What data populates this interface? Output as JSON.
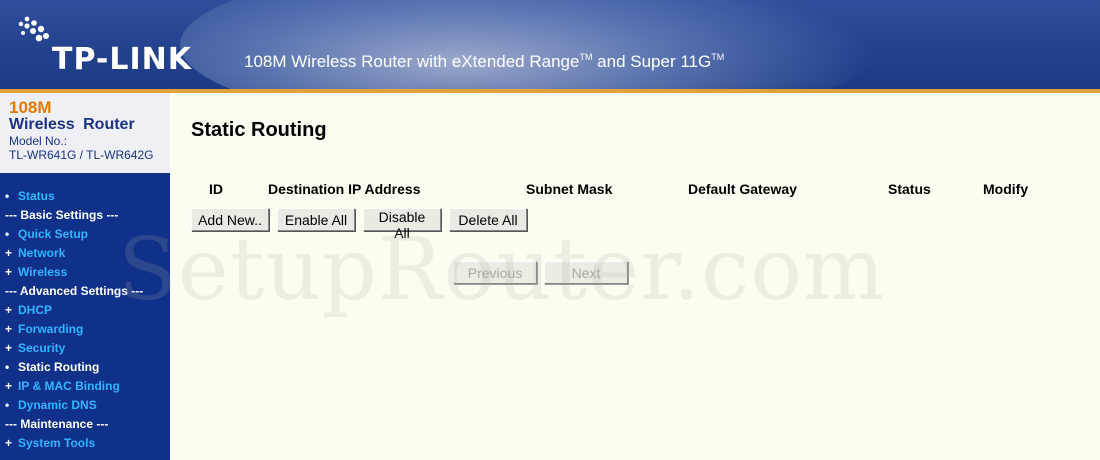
{
  "header": {
    "logo_text": "TP-LINK",
    "tagline_main": "108M Wireless Router with eXtended Range",
    "tagline_tm1": "TM",
    "tagline_mid": " and Super 11G",
    "tagline_tm2": "TM",
    "colors": {
      "header_bg": "#22408c",
      "accent_bar": "#e2a23a"
    }
  },
  "brand": {
    "line1": "108M",
    "line2": "Wireless Router",
    "line3": "Model No.:",
    "line4": "TL-WR641G / TL-WR642G"
  },
  "sidebar": {
    "items": [
      {
        "type": "link",
        "bullet": "•",
        "label": "Status"
      },
      {
        "type": "section",
        "bullet": "",
        "label": "--- Basic Settings ---"
      },
      {
        "type": "link",
        "bullet": "•",
        "label": "Quick Setup"
      },
      {
        "type": "link",
        "bullet": "+",
        "label": "Network"
      },
      {
        "type": "link",
        "bullet": "+",
        "label": "Wireless"
      },
      {
        "type": "section",
        "bullet": "",
        "label": "--- Advanced Settings ---"
      },
      {
        "type": "link",
        "bullet": "+",
        "label": "DHCP"
      },
      {
        "type": "link",
        "bullet": "+",
        "label": "Forwarding"
      },
      {
        "type": "link",
        "bullet": "+",
        "label": "Security"
      },
      {
        "type": "current",
        "bullet": "•",
        "label": "Static Routing"
      },
      {
        "type": "link",
        "bullet": "+",
        "label": "IP & MAC Binding"
      },
      {
        "type": "link",
        "bullet": "•",
        "label": "Dynamic DNS"
      },
      {
        "type": "section",
        "bullet": "",
        "label": "--- Maintenance ---"
      },
      {
        "type": "link",
        "bullet": "+",
        "label": "System Tools"
      }
    ]
  },
  "main": {
    "title": "Static Routing",
    "columns": [
      "ID",
      "Destination IP Address",
      "Subnet Mask",
      "Default Gateway",
      "Status",
      "Modify"
    ],
    "buttons": {
      "add_new": "Add New..",
      "enable_all": "Enable All",
      "disable_all": "Disable All",
      "delete_all": "Delete All",
      "previous": "Previous",
      "next": "Next"
    }
  },
  "watermark": "SetupRouter.com"
}
